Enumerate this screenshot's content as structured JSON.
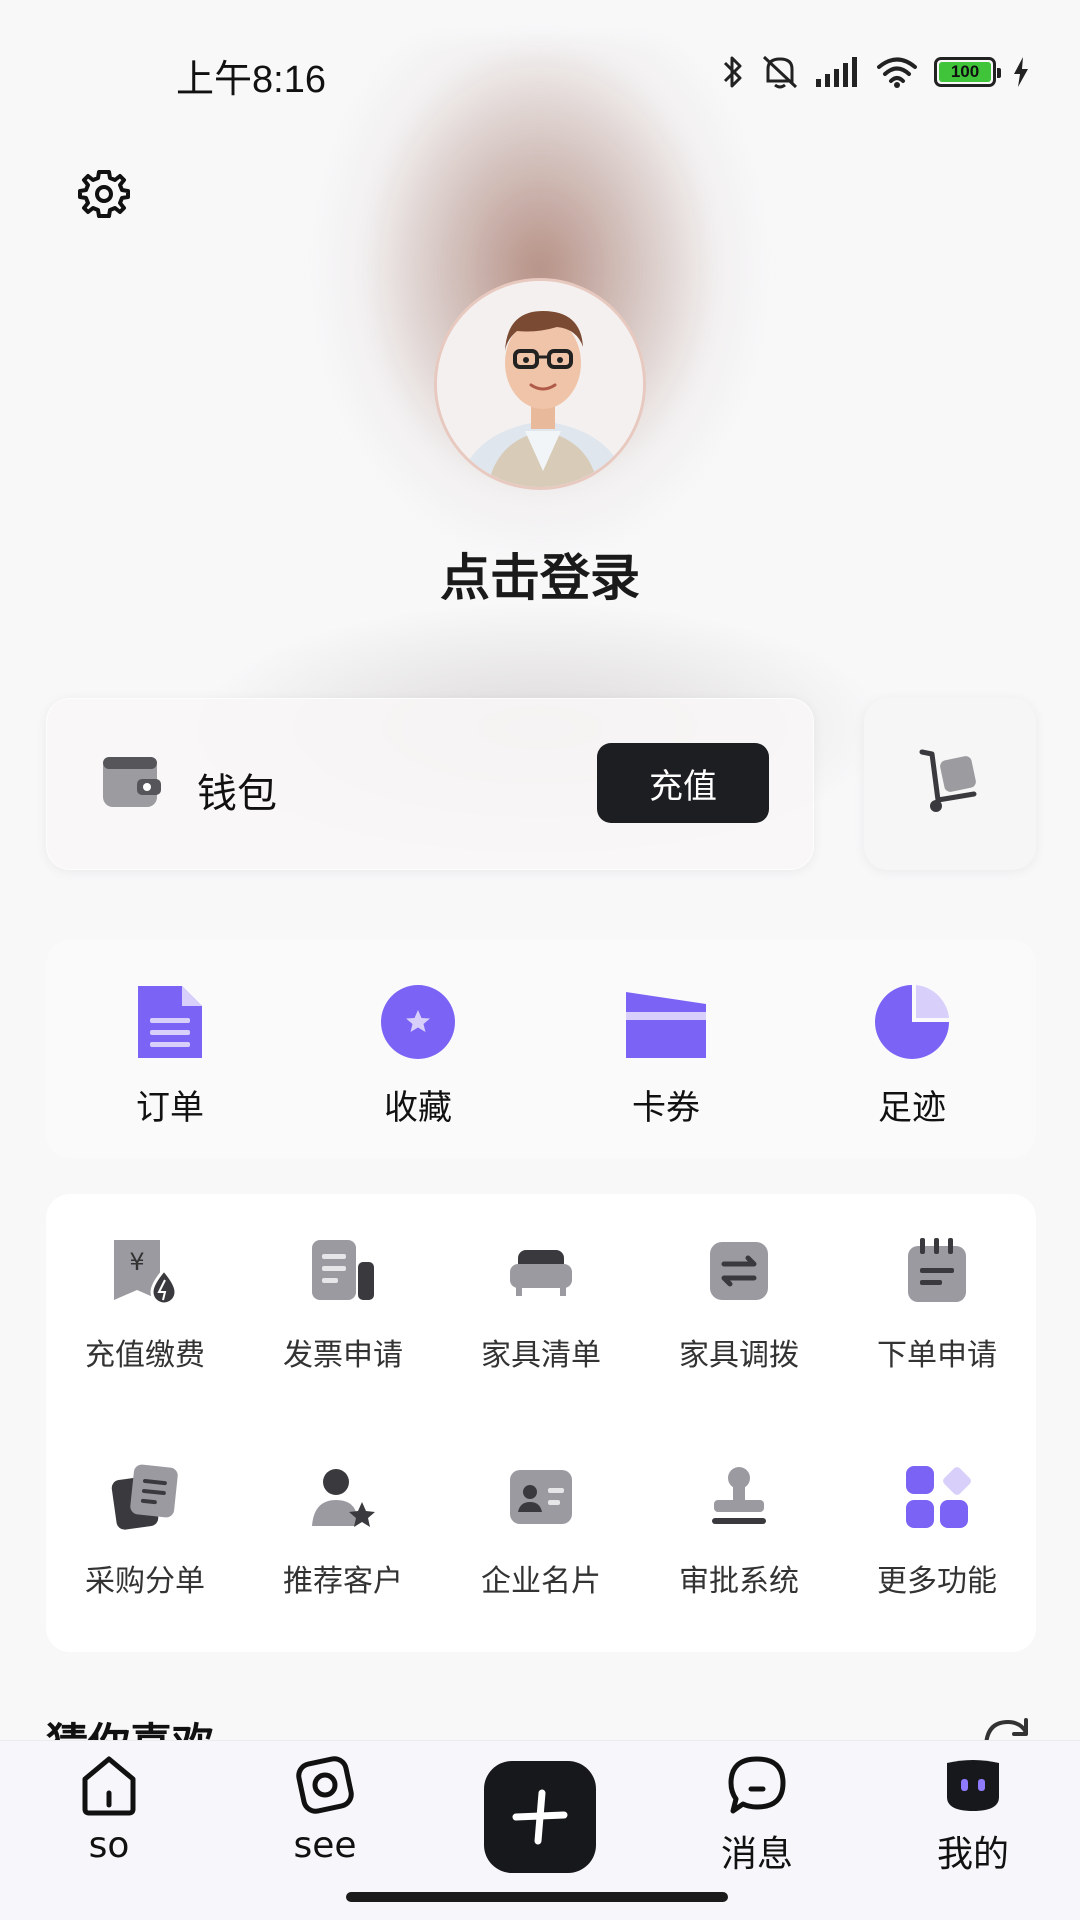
{
  "status_bar": {
    "time": "上午8:16",
    "battery_level": "100",
    "icons": [
      "bluetooth-icon",
      "mute-icon",
      "signal-icon",
      "wifi-icon",
      "battery-icon",
      "charging-icon"
    ]
  },
  "header": {
    "settings_icon": "gear-icon",
    "login_text": "点击登录"
  },
  "wallet": {
    "icon": "wallet-icon",
    "label": "钱包",
    "recharge_label": "充值",
    "cart_icon": "cart-icon"
  },
  "quick_actions": [
    {
      "label": "订单",
      "icon": "document-icon"
    },
    {
      "label": "收藏",
      "icon": "star-icon"
    },
    {
      "label": "卡券",
      "icon": "card-icon"
    },
    {
      "label": "足迹",
      "icon": "pie-clock-icon"
    }
  ],
  "services": [
    {
      "label": "充值缴费",
      "icon": "payment-icon"
    },
    {
      "label": "发票申请",
      "icon": "invoice-icon"
    },
    {
      "label": "家具清单",
      "icon": "sofa-icon"
    },
    {
      "label": "家具调拨",
      "icon": "transfer-icon"
    },
    {
      "label": "下单申请",
      "icon": "notepad-icon"
    },
    {
      "label": "采购分单",
      "icon": "documents-icon"
    },
    {
      "label": "推荐客户",
      "icon": "user-star-icon"
    },
    {
      "label": "企业名片",
      "icon": "business-card-icon"
    },
    {
      "label": "审批系统",
      "icon": "stamp-icon"
    },
    {
      "label": "更多功能",
      "icon": "grid-more-icon"
    }
  ],
  "recommend": {
    "title": "猜你喜欢",
    "refresh_icon": "refresh-icon"
  },
  "tabbar": [
    {
      "label": "so",
      "icon": "home-icon"
    },
    {
      "label": "see",
      "icon": "compass-icon"
    },
    {
      "label": "",
      "icon": "plus-icon"
    },
    {
      "label": "消息",
      "icon": "chat-icon"
    },
    {
      "label": "我的",
      "icon": "robot-face-icon"
    }
  ],
  "colors": {
    "accent": "#7b63f6",
    "accent_light": "#d8d0fb",
    "gray_icon": "#8e8e93",
    "dark": "#1d1e22"
  }
}
